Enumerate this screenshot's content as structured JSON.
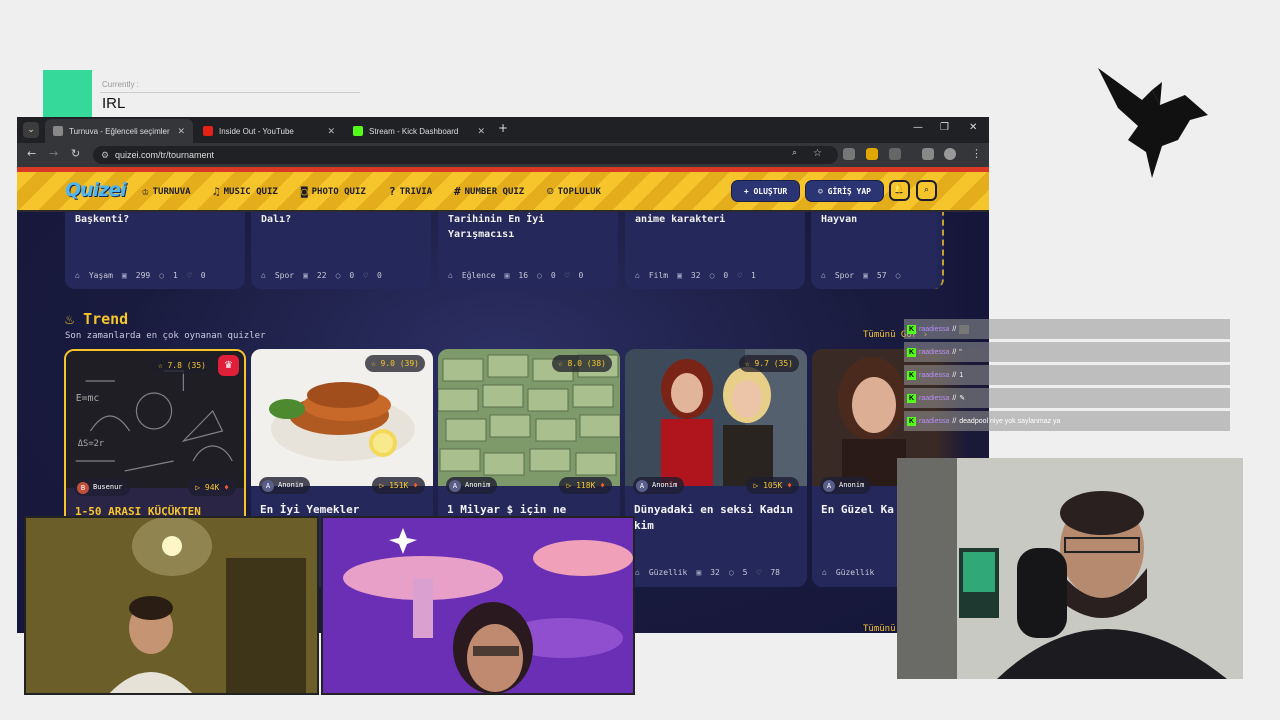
{
  "overlay": {
    "currently_label": "Currently :",
    "currently_value": "IRL"
  },
  "browser": {
    "tabs": [
      {
        "title": "Turnuva - Eğlenceli seçimler ya",
        "active": true
      },
      {
        "title": "Inside Out - YouTube",
        "active": false
      },
      {
        "title": "Stream - Kick Dashboard",
        "active": false
      }
    ],
    "url": "quizei.com/tr/tournament"
  },
  "site": {
    "logo": "Quizei",
    "nav": [
      {
        "label": "TURNUVA",
        "icon": "trophy-icon"
      },
      {
        "label": "MUSIC QUIZ",
        "icon": "music-icon"
      },
      {
        "label": "PHOTO QUIZ",
        "icon": "camera-icon"
      },
      {
        "label": "TRIVIA",
        "icon": "question-icon"
      },
      {
        "label": "NUMBER QUIZ",
        "icon": "hash-icon"
      },
      {
        "label": "TOPLULUK",
        "icon": "users-icon"
      }
    ],
    "create_label": "+ OLUŞTUR",
    "login_label": "GİRİŞ YAP",
    "top_cards": [
      {
        "title": "Başkenti?",
        "category": "Yaşam",
        "count": "299",
        "comments": "1",
        "likes": "0"
      },
      {
        "title": "Dalı?",
        "category": "Spor",
        "count": "22",
        "comments": "0",
        "likes": "0"
      },
      {
        "title": "Tarihinin En İyi Yarışmacısı",
        "category": "Eğlence",
        "count": "16",
        "comments": "0",
        "likes": "0"
      },
      {
        "title": "anime karakteri",
        "category": "Film",
        "count": "32",
        "comments": "0",
        "likes": "1"
      },
      {
        "title": "Hayvan",
        "category": "Spor",
        "count": "57",
        "comments": "0",
        "likes": ""
      }
    ],
    "trend": {
      "heading": "Trend",
      "subtitle": "Son zamanlarda en çok oynanan quizler",
      "see_all": "Tümünü Gör ›",
      "see_all_bottom": "Tümünü",
      "cards": [
        {
          "rating": "7.8 (35)",
          "author": "Busenur",
          "author_initial": "B",
          "plays": "94K",
          "title": "1-50 ARASI KÜÇÜKTEN",
          "category": "",
          "count": "",
          "comments": "",
          "likes": ""
        },
        {
          "rating": "9.0 (39)",
          "author": "Anonim",
          "author_initial": "A",
          "plays": "151K",
          "title": "En İyi Yemekler",
          "category": "",
          "count": "",
          "comments": "",
          "likes": ""
        },
        {
          "rating": "8.0 (38)",
          "author": "Anonim",
          "author_initial": "A",
          "plays": "118K",
          "title": "1 Milyar $ için ne",
          "category": "",
          "count": "",
          "comments": "",
          "likes": ""
        },
        {
          "rating": "9.7 (35)",
          "author": "Anonim",
          "author_initial": "A",
          "plays": "105K",
          "title": "Dünyadaki en seksi Kadın kim",
          "category": "Güzellik",
          "count": "32",
          "comments": "5",
          "likes": "78"
        },
        {
          "rating": "",
          "author": "Anonim",
          "author_initial": "A",
          "plays": "",
          "title": "En Güzel Ka",
          "category": "Güzellik",
          "count": "",
          "comments": "",
          "likes": ""
        }
      ]
    }
  },
  "chat": [
    {
      "user": "raadiessa",
      "message": ""
    },
    {
      "user": "raadiessa",
      "message": "\""
    },
    {
      "user": "raadiessa",
      "message": "1"
    },
    {
      "user": "raadiessa",
      "message": ""
    },
    {
      "user": "raadiessa",
      "message": "deadpool niye yok saylanmaz ya"
    }
  ],
  "colors": {
    "accent_green": "#35d99a",
    "brand_yellow": "#f6c52b",
    "site_bg": "#191b3e",
    "kick_green": "#53fc18"
  }
}
